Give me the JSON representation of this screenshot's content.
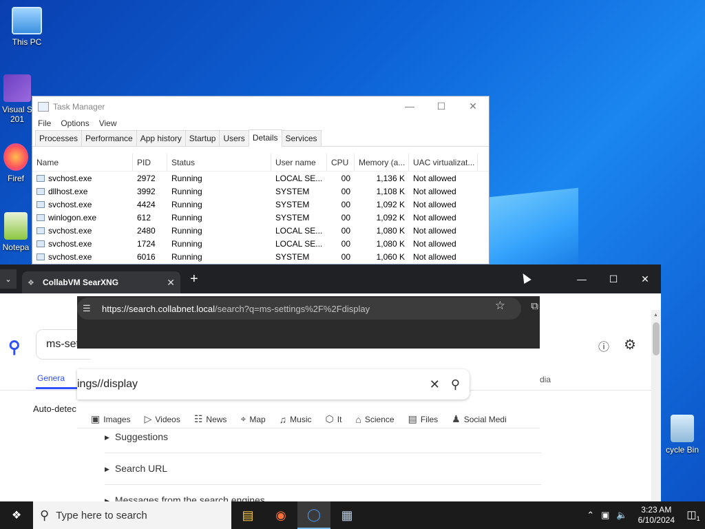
{
  "desktop": {
    "icons": [
      {
        "label": "This PC",
        "icon": "computer-icon"
      },
      {
        "label": "Visual S\n201",
        "icon": "visual-studio-icon"
      },
      {
        "label": "Firef",
        "icon": "firefox-icon"
      },
      {
        "label": "Notepa",
        "icon": "notepad-icon"
      },
      {
        "label": "cycle Bin",
        "icon": "recycle-bin-icon"
      }
    ]
  },
  "task_manager": {
    "title": "Task Manager",
    "menu": [
      "File",
      "Options",
      "View"
    ],
    "tabs": [
      "Processes",
      "Performance",
      "App history",
      "Startup",
      "Users",
      "Details",
      "Services"
    ],
    "active_tab": "Details",
    "columns": [
      "Name",
      "PID",
      "Status",
      "User name",
      "CPU",
      "Memory (a...",
      "UAC virtualizat..."
    ],
    "rows": [
      [
        "svchost.exe",
        "2972",
        "Running",
        "LOCAL SE...",
        "00",
        "1,136 K",
        "Not allowed"
      ],
      [
        "dllhost.exe",
        "3992",
        "Running",
        "SYSTEM",
        "00",
        "1,108 K",
        "Not allowed"
      ],
      [
        "svchost.exe",
        "4424",
        "Running",
        "SYSTEM",
        "00",
        "1,092 K",
        "Not allowed"
      ],
      [
        "winlogon.exe",
        "612",
        "Running",
        "SYSTEM",
        "00",
        "1,092 K",
        "Not allowed"
      ],
      [
        "svchost.exe",
        "2480",
        "Running",
        "LOCAL SE...",
        "00",
        "1,080 K",
        "Not allowed"
      ],
      [
        "svchost.exe",
        "1724",
        "Running",
        "LOCAL SE...",
        "00",
        "1,080 K",
        "Not allowed"
      ],
      [
        "svchost.exe",
        "6016",
        "Running",
        "SYSTEM",
        "00",
        "1,060 K",
        "Not allowed"
      ]
    ]
  },
  "browser": {
    "tab_title": "CollabVM SearXNG",
    "url_host": "https://search.collabnet.local",
    "url_rest": "/search?q=ms-settings%2F%2Fdisplay",
    "new_tab": "+"
  },
  "page": {
    "query_left": "ms-set",
    "query_overlay": "ings//display",
    "general_tab": "Genera",
    "auto_detect": "Auto-detec",
    "dia_fragment": "dia",
    "categories": [
      {
        "label": "Images",
        "icon": "image-icon"
      },
      {
        "label": "Videos",
        "icon": "play-icon"
      },
      {
        "label": "News",
        "icon": "newspaper-icon"
      },
      {
        "label": "Map",
        "icon": "map-pin-icon"
      },
      {
        "label": "Music",
        "icon": "music-icon"
      },
      {
        "label": "It",
        "icon": "layers-icon"
      },
      {
        "label": "Science",
        "icon": "science-icon"
      },
      {
        "label": "Files",
        "icon": "files-icon"
      },
      {
        "label": "Social Medi",
        "icon": "users-icon"
      }
    ],
    "sections": [
      "Suggestions",
      "Search URL",
      "Messages from the search engines"
    ]
  },
  "taskbar": {
    "search_placeholder": "Type here to search",
    "time": "3:23 AM",
    "date": "6/10/2024",
    "notification_count": "1"
  }
}
